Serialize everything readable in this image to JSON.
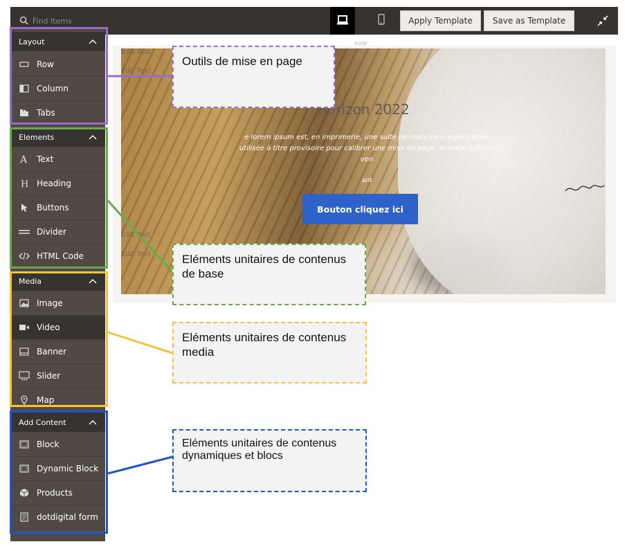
{
  "toolbar": {
    "search_placeholder": "Find items",
    "apply_template": "Apply Template",
    "save_as_template": "Save as Template"
  },
  "sidebar": {
    "layout": {
      "title": "Layout",
      "items": [
        {
          "label": "Row",
          "icon": "row-icon"
        },
        {
          "label": "Column",
          "icon": "column-icon"
        },
        {
          "label": "Tabs",
          "icon": "tabs-icon"
        }
      ]
    },
    "elements": {
      "title": "Elements",
      "items": [
        {
          "label": "Text",
          "icon": "text-icon"
        },
        {
          "label": "Heading",
          "icon": "heading-icon"
        },
        {
          "label": "Buttons",
          "icon": "cursor-icon"
        },
        {
          "label": "Divider",
          "icon": "divider-icon"
        },
        {
          "label": "HTML Code",
          "icon": "code-icon"
        }
      ]
    },
    "media": {
      "title": "Media",
      "items": [
        {
          "label": "Image",
          "icon": "image-icon"
        },
        {
          "label": "Video",
          "icon": "video-icon"
        },
        {
          "label": "Banner",
          "icon": "banner-icon"
        },
        {
          "label": "Slider",
          "icon": "slider-icon"
        },
        {
          "label": "Map",
          "icon": "map-pin-icon"
        }
      ]
    },
    "add_content": {
      "title": "Add Content",
      "items": [
        {
          "label": "Block",
          "icon": "block-icon"
        },
        {
          "label": "Dynamic Block",
          "icon": "dynamic-block-icon"
        },
        {
          "label": "Products",
          "icon": "products-icon"
        },
        {
          "label": "dotdigital form",
          "icon": "form-icon"
        }
      ]
    }
  },
  "stage": {
    "row_label": "ROW",
    "edit_text": "Edit Text",
    "banner": {
      "title": "Horizon 2022",
      "body": "e lorem ipsum est, en imprimerie, une suite de mots sans signification utilisée à titre provisoire pour calibrer une mise en page, le texte définitif ven",
      "small": "ant",
      "button": "Bouton cliquez ici"
    }
  },
  "callouts": {
    "layout_tools": "Outils de mise en page",
    "base_elements": "Eléments unitaires de contenus de base",
    "media_elements": "Eléments unitaires de contenus media",
    "dynamic_elements": "Eléments unitaires de contenus dynamiques et blocs"
  },
  "colors": {
    "purple": "#9b6cc8",
    "green": "#6aaa4b",
    "yellow": "#f2c43a",
    "blue": "#1f55c4",
    "cta": "#2d63c8",
    "sidebar_bg": "#514943",
    "header_bg": "#373330"
  }
}
